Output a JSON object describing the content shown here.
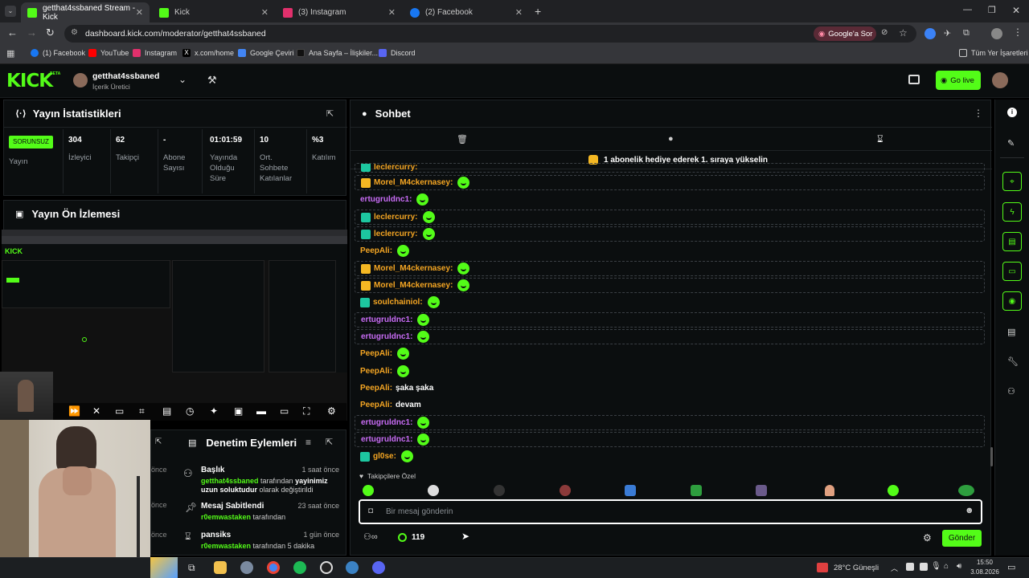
{
  "browser": {
    "tabs": [
      {
        "title": "getthat4ssbaned Stream - Kick",
        "color": "#53fc18"
      },
      {
        "title": "Kick",
        "color": "#53fc18"
      },
      {
        "title": "(3) Instagram",
        "color": "#e1306c"
      },
      {
        "title": "(2) Facebook",
        "color": "#1877f2"
      }
    ],
    "url": "dashboard.kick.com/moderator/getthat4ssbaned",
    "google_lens": "Google'a Sor",
    "bookmarks": [
      "(1) Facebook",
      "YouTube",
      "Instagram",
      "x.com/home",
      "Google Çeviri",
      "Ana Sayfa – İlişkiler...",
      "Discord"
    ],
    "all_bookmarks": "Tüm Yer İşaretleri"
  },
  "header": {
    "logo": "KICK",
    "beta": "BETA",
    "channel_name": "getthat4ssbaned",
    "channel_role": "İçerik Üretici",
    "go_live": "Go live"
  },
  "stats": {
    "title": "Yayın İstatistikleri",
    "status_badge": "SORUNSUZ",
    "status_label": "Yayın",
    "items": [
      {
        "value": "304",
        "label": "İzleyici"
      },
      {
        "value": "62",
        "label": "Takipçi"
      },
      {
        "value": "-",
        "label": "Abone Sayısı"
      },
      {
        "value": "01:01:59",
        "label": "Yayında Olduğu Süre"
      },
      {
        "value": "10",
        "label": "Ort. Sohbete Katılanlar"
      },
      {
        "value": "%3",
        "label": "Katılım"
      }
    ]
  },
  "preview": {
    "title": "Yayın Ön İzlemesi"
  },
  "moderation": {
    "title": "Denetim Eylemleri",
    "time_frag": [
      "önce",
      "önce",
      "önce"
    ],
    "actions": [
      {
        "title": "Başlık",
        "when": "1 saat önce",
        "user": "getthat4ssbaned",
        "mid": " tarafından ",
        "highlight": "yayinimiz uzun soluktudur",
        "rest": " olarak değiştirildi"
      },
      {
        "title": "Mesaj Sabitlendi",
        "when": "23 saat önce",
        "user": "r0emwastaken",
        "mid": " tarafından",
        "highlight": "",
        "rest": ""
      },
      {
        "title": "pansiks",
        "when": "1 gün önce",
        "user": "r0emwastaken",
        "mid": " tarafından 5 dakika",
        "highlight": "",
        "rest": ""
      }
    ]
  },
  "chat": {
    "title": "Sohbet",
    "promo": "1 abonelik hediye ederek 1. sıraya yükselin",
    "messages": [
      {
        "user": "Morel_M4ckernasey",
        "color": "#f5a623",
        "text": "",
        "box": true,
        "badge": "crown"
      },
      {
        "user": "ertugruldnc1",
        "color": "#c86cf5",
        "text": "",
        "box": false,
        "badge": ""
      },
      {
        "user": "leclercurry",
        "color": "#f5a623",
        "text": "",
        "box": true,
        "badge": "sub"
      },
      {
        "user": "leclercurry",
        "color": "#f5a623",
        "text": "",
        "box": true,
        "badge": "sub"
      },
      {
        "user": "PeepAli",
        "color": "#f5a623",
        "text": "",
        "box": false,
        "badge": ""
      },
      {
        "user": "Morel_M4ckernasey",
        "color": "#f5a623",
        "text": "",
        "box": true,
        "badge": "crown"
      },
      {
        "user": "Morel_M4ckernasey",
        "color": "#f5a623",
        "text": "",
        "box": true,
        "badge": "crown"
      },
      {
        "user": "soulchainiol",
        "color": "#f5a623",
        "text": "",
        "box": false,
        "badge": "sub2"
      },
      {
        "user": "ertugruldnc1",
        "color": "#c86cf5",
        "text": "",
        "box": true,
        "badge": ""
      },
      {
        "user": "ertugruldnc1",
        "color": "#c86cf5",
        "text": "",
        "box": true,
        "badge": ""
      },
      {
        "user": "PeepAli",
        "color": "#f5a623",
        "text": "",
        "box": false,
        "badge": ""
      },
      {
        "user": "PeepAli",
        "color": "#f5a623",
        "text": "",
        "box": false,
        "badge": ""
      },
      {
        "user": "PeepAli",
        "color": "#f5a623",
        "text": "şaka şaka",
        "box": false,
        "badge": ""
      },
      {
        "user": "PeepAli",
        "color": "#f5a623",
        "text": "devam",
        "box": false,
        "badge": ""
      },
      {
        "user": "ertugruldnc1",
        "color": "#c86cf5",
        "text": "",
        "box": true,
        "badge": ""
      },
      {
        "user": "ertugruldnc1",
        "color": "#c86cf5",
        "text": "",
        "box": true,
        "badge": ""
      },
      {
        "user": "gl0se",
        "color": "#f5a623",
        "text": "",
        "box": false,
        "badge": "sub2"
      }
    ],
    "emote_section": "Takipçilere Özel",
    "input_placeholder": "Bir mesaj gönderin",
    "points": "119",
    "send": "Gönder"
  },
  "taskbar": {
    "weather": "28°C  Güneşli",
    "time": "15:50",
    "date": "3.08.2026"
  }
}
